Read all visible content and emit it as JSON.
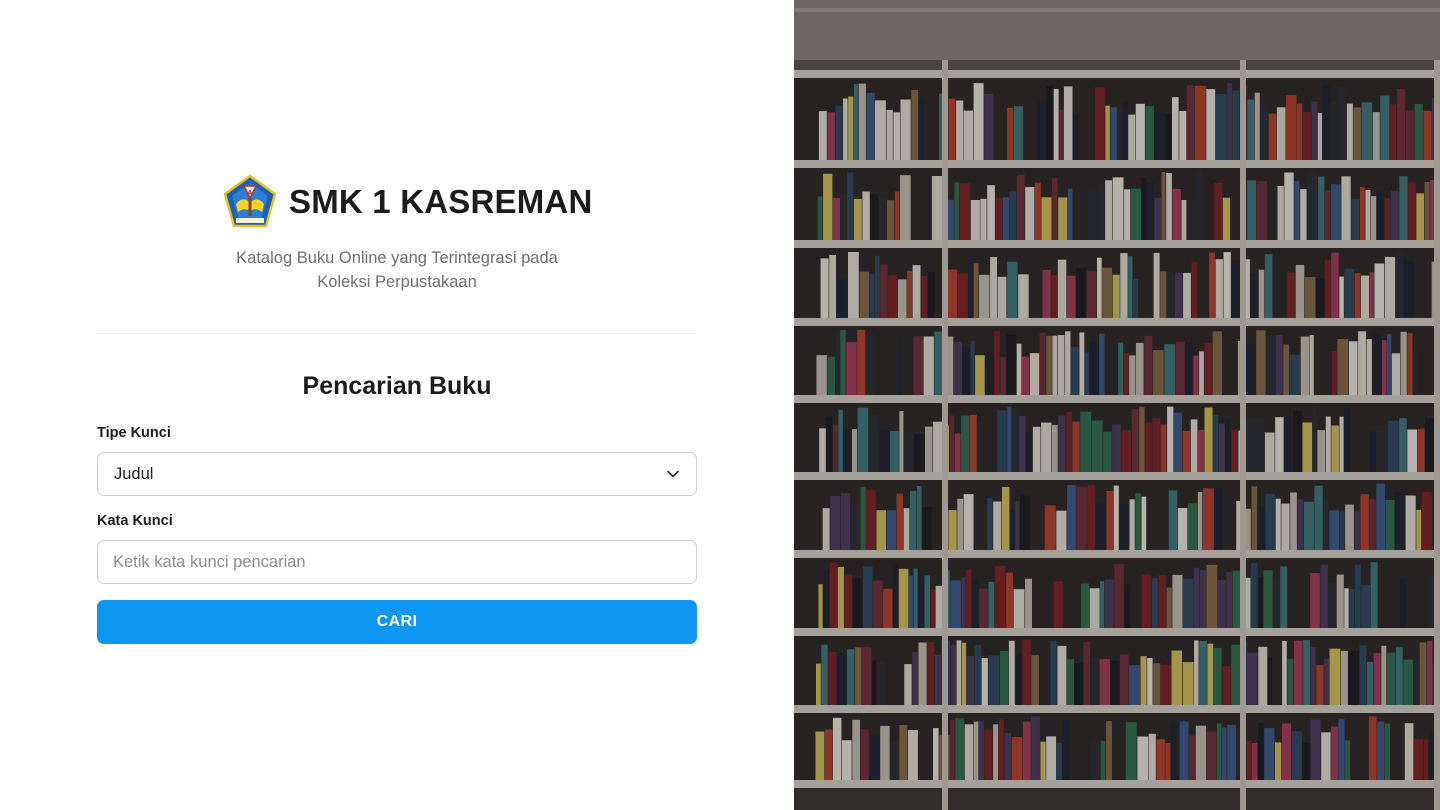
{
  "brand": {
    "school_name": "SMK 1 KASREMAN",
    "logo_icon": "school-crest-icon",
    "tagline_line1": "Katalog Buku Online yang Terintegrasi pada",
    "tagline_line2": "Koleksi Perpustakaan"
  },
  "form": {
    "title": "Pencarian Buku",
    "key_type_label": "Tipe Kunci",
    "key_type_selected": "Judul",
    "keyword_label": "Kata Kunci",
    "keyword_placeholder": "Ketik kata kunci pencarian",
    "keyword_value": "",
    "submit_label": "CARI"
  },
  "colors": {
    "accent": "#0d96f2",
    "border": "#cfcfcf",
    "muted_text": "#6f6f6f"
  },
  "hero_image": {
    "subject": "bookshelf-photo"
  }
}
